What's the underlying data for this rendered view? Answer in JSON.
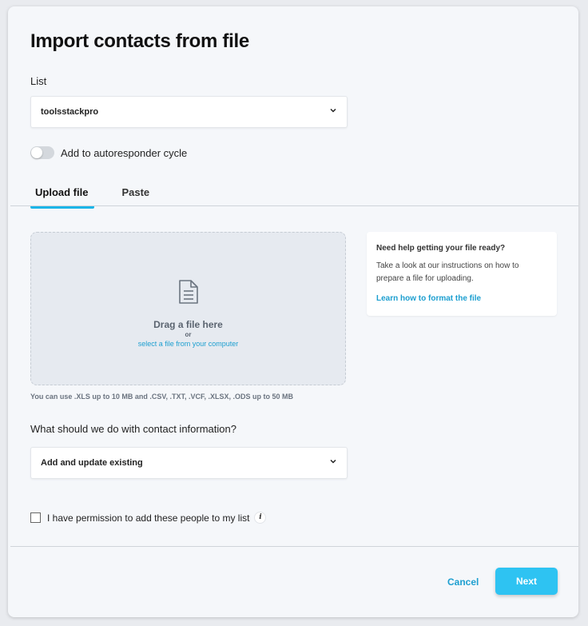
{
  "dialog": {
    "title": "Import contacts from file",
    "list_label": "List",
    "list_value": "toolsstackpro",
    "autoresponder_label": "Add to autoresponder cycle",
    "autoresponder_on": false
  },
  "tabs": [
    {
      "label": "Upload file",
      "active": true
    },
    {
      "label": "Paste",
      "active": false
    }
  ],
  "dropzone": {
    "icon": "file-document-icon",
    "title": "Drag a file here",
    "or": "or",
    "link": "select a file from your computer"
  },
  "hint": "You can use .XLS up to 10 MB and .CSV, .TXT, .VCF, .XLSX, .ODS up to 50 MB",
  "help": {
    "title": "Need help getting your file ready?",
    "body": "Take a look at our instructions on how to prepare a file for uploading.",
    "link": "Learn how to format the file"
  },
  "contact_info": {
    "question": "What should we do with contact information?",
    "value": "Add and update existing"
  },
  "permission": {
    "label": "I have permission to add these people to my list",
    "checked": false,
    "info_icon": "i"
  },
  "footer": {
    "cancel": "Cancel",
    "next": "Next"
  },
  "colors": {
    "accent": "#1d9fd0",
    "primary_button": "#2ec3f2",
    "tab_underline": "#1bb5e8"
  }
}
